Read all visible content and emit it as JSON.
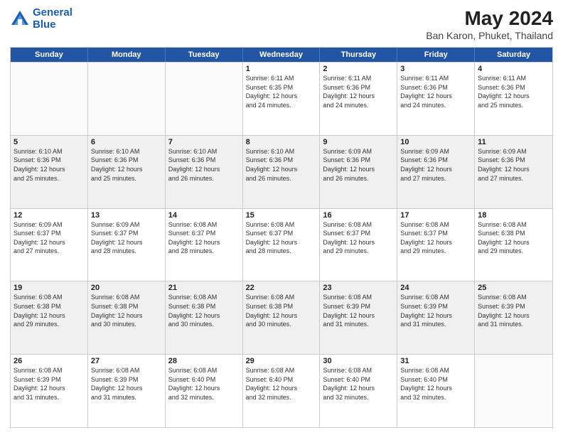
{
  "header": {
    "logo_line1": "General",
    "logo_line2": "Blue",
    "title": "May 2024",
    "subtitle": "Ban Karon, Phuket, Thailand"
  },
  "weekdays": [
    "Sunday",
    "Monday",
    "Tuesday",
    "Wednesday",
    "Thursday",
    "Friday",
    "Saturday"
  ],
  "rows": [
    [
      {
        "day": "",
        "info": [],
        "empty": true
      },
      {
        "day": "",
        "info": [],
        "empty": true
      },
      {
        "day": "",
        "info": [],
        "empty": true
      },
      {
        "day": "1",
        "info": [
          "Sunrise: 6:11 AM",
          "Sunset: 6:35 PM",
          "Daylight: 12 hours",
          "and 24 minutes."
        ],
        "empty": false
      },
      {
        "day": "2",
        "info": [
          "Sunrise: 6:11 AM",
          "Sunset: 6:36 PM",
          "Daylight: 12 hours",
          "and 24 minutes."
        ],
        "empty": false
      },
      {
        "day": "3",
        "info": [
          "Sunrise: 6:11 AM",
          "Sunset: 6:36 PM",
          "Daylight: 12 hours",
          "and 24 minutes."
        ],
        "empty": false
      },
      {
        "day": "4",
        "info": [
          "Sunrise: 6:11 AM",
          "Sunset: 6:36 PM",
          "Daylight: 12 hours",
          "and 25 minutes."
        ],
        "empty": false
      }
    ],
    [
      {
        "day": "5",
        "info": [
          "Sunrise: 6:10 AM",
          "Sunset: 6:36 PM",
          "Daylight: 12 hours",
          "and 25 minutes."
        ],
        "shaded": true
      },
      {
        "day": "6",
        "info": [
          "Sunrise: 6:10 AM",
          "Sunset: 6:36 PM",
          "Daylight: 12 hours",
          "and 25 minutes."
        ],
        "shaded": true
      },
      {
        "day": "7",
        "info": [
          "Sunrise: 6:10 AM",
          "Sunset: 6:36 PM",
          "Daylight: 12 hours",
          "and 26 minutes."
        ],
        "shaded": true
      },
      {
        "day": "8",
        "info": [
          "Sunrise: 6:10 AM",
          "Sunset: 6:36 PM",
          "Daylight: 12 hours",
          "and 26 minutes."
        ],
        "shaded": true
      },
      {
        "day": "9",
        "info": [
          "Sunrise: 6:09 AM",
          "Sunset: 6:36 PM",
          "Daylight: 12 hours",
          "and 26 minutes."
        ],
        "shaded": true
      },
      {
        "day": "10",
        "info": [
          "Sunrise: 6:09 AM",
          "Sunset: 6:36 PM",
          "Daylight: 12 hours",
          "and 27 minutes."
        ],
        "shaded": true
      },
      {
        "day": "11",
        "info": [
          "Sunrise: 6:09 AM",
          "Sunset: 6:36 PM",
          "Daylight: 12 hours",
          "and 27 minutes."
        ],
        "shaded": true
      }
    ],
    [
      {
        "day": "12",
        "info": [
          "Sunrise: 6:09 AM",
          "Sunset: 6:37 PM",
          "Daylight: 12 hours",
          "and 27 minutes."
        ]
      },
      {
        "day": "13",
        "info": [
          "Sunrise: 6:09 AM",
          "Sunset: 6:37 PM",
          "Daylight: 12 hours",
          "and 28 minutes."
        ]
      },
      {
        "day": "14",
        "info": [
          "Sunrise: 6:08 AM",
          "Sunset: 6:37 PM",
          "Daylight: 12 hours",
          "and 28 minutes."
        ]
      },
      {
        "day": "15",
        "info": [
          "Sunrise: 6:08 AM",
          "Sunset: 6:37 PM",
          "Daylight: 12 hours",
          "and 28 minutes."
        ]
      },
      {
        "day": "16",
        "info": [
          "Sunrise: 6:08 AM",
          "Sunset: 6:37 PM",
          "Daylight: 12 hours",
          "and 29 minutes."
        ]
      },
      {
        "day": "17",
        "info": [
          "Sunrise: 6:08 AM",
          "Sunset: 6:37 PM",
          "Daylight: 12 hours",
          "and 29 minutes."
        ]
      },
      {
        "day": "18",
        "info": [
          "Sunrise: 6:08 AM",
          "Sunset: 6:38 PM",
          "Daylight: 12 hours",
          "and 29 minutes."
        ]
      }
    ],
    [
      {
        "day": "19",
        "info": [
          "Sunrise: 6:08 AM",
          "Sunset: 6:38 PM",
          "Daylight: 12 hours",
          "and 29 minutes."
        ],
        "shaded": true
      },
      {
        "day": "20",
        "info": [
          "Sunrise: 6:08 AM",
          "Sunset: 6:38 PM",
          "Daylight: 12 hours",
          "and 30 minutes."
        ],
        "shaded": true
      },
      {
        "day": "21",
        "info": [
          "Sunrise: 6:08 AM",
          "Sunset: 6:38 PM",
          "Daylight: 12 hours",
          "and 30 minutes."
        ],
        "shaded": true
      },
      {
        "day": "22",
        "info": [
          "Sunrise: 6:08 AM",
          "Sunset: 6:38 PM",
          "Daylight: 12 hours",
          "and 30 minutes."
        ],
        "shaded": true
      },
      {
        "day": "23",
        "info": [
          "Sunrise: 6:08 AM",
          "Sunset: 6:39 PM",
          "Daylight: 12 hours",
          "and 31 minutes."
        ],
        "shaded": true
      },
      {
        "day": "24",
        "info": [
          "Sunrise: 6:08 AM",
          "Sunset: 6:39 PM",
          "Daylight: 12 hours",
          "and 31 minutes."
        ],
        "shaded": true
      },
      {
        "day": "25",
        "info": [
          "Sunrise: 6:08 AM",
          "Sunset: 6:39 PM",
          "Daylight: 12 hours",
          "and 31 minutes."
        ],
        "shaded": true
      }
    ],
    [
      {
        "day": "26",
        "info": [
          "Sunrise: 6:08 AM",
          "Sunset: 6:39 PM",
          "Daylight: 12 hours",
          "and 31 minutes."
        ]
      },
      {
        "day": "27",
        "info": [
          "Sunrise: 6:08 AM",
          "Sunset: 6:39 PM",
          "Daylight: 12 hours",
          "and 31 minutes."
        ]
      },
      {
        "day": "28",
        "info": [
          "Sunrise: 6:08 AM",
          "Sunset: 6:40 PM",
          "Daylight: 12 hours",
          "and 32 minutes."
        ]
      },
      {
        "day": "29",
        "info": [
          "Sunrise: 6:08 AM",
          "Sunset: 6:40 PM",
          "Daylight: 12 hours",
          "and 32 minutes."
        ]
      },
      {
        "day": "30",
        "info": [
          "Sunrise: 6:08 AM",
          "Sunset: 6:40 PM",
          "Daylight: 12 hours",
          "and 32 minutes."
        ]
      },
      {
        "day": "31",
        "info": [
          "Sunrise: 6:08 AM",
          "Sunset: 6:40 PM",
          "Daylight: 12 hours",
          "and 32 minutes."
        ]
      },
      {
        "day": "",
        "info": [],
        "empty": true
      }
    ]
  ]
}
